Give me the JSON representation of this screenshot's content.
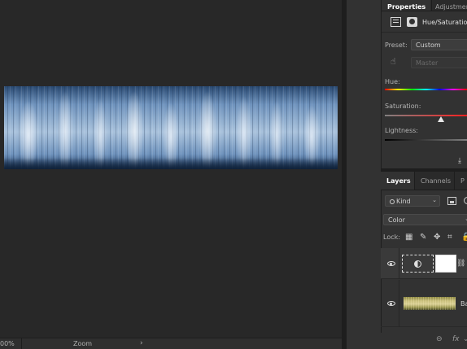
{
  "status_bar": {
    "zoom_percent": "00%",
    "tool_label": "Zoom",
    "expand_glyph": "›"
  },
  "properties_panel": {
    "tabs": [
      {
        "label": "Properties"
      },
      {
        "label": "Adjustments"
      }
    ],
    "adjustment_title": "Hue/Saturation",
    "preset_label": "Preset:",
    "preset_value": "Custom",
    "channel_value": "Master",
    "hue_label": "Hue:",
    "saturation_label": "Saturation:",
    "lightness_label": "Lightness:",
    "hand_icon": "targeted-adjustment-hand-icon"
  },
  "layers_panel": {
    "tabs": [
      {
        "label": "Layers"
      },
      {
        "label": "Channels"
      },
      {
        "label": "P"
      }
    ],
    "filter_kind": "Kind",
    "blend_mode": "Color",
    "lock_label": "Lock:",
    "layers": [
      {
        "name": "",
        "type": "Hue/Saturation adjustment",
        "visible": true,
        "selected": true
      },
      {
        "name": "Ba",
        "type": "image",
        "visible": true,
        "selected": false
      }
    ]
  },
  "colors": {
    "workspace_bg": "#282828",
    "panel_bg": "#323232",
    "image_blue_dark": "#1c3558",
    "image_blue_light": "#a9c2dc"
  }
}
